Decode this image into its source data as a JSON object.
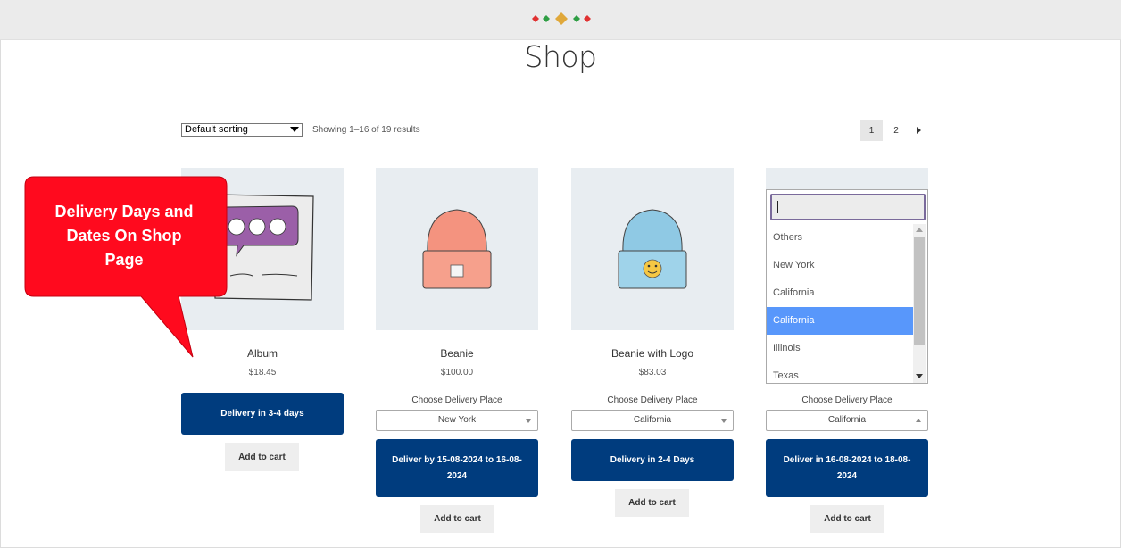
{
  "page": {
    "title": "Shop"
  },
  "header": {
    "logo_icon": "woocommerce-diamond-logo-icon",
    "logo_colors": [
      "#e03131",
      "#2f9e44",
      "#e0a83a",
      "#2f9e44",
      "#e03131"
    ]
  },
  "toolbar": {
    "sort_selected": "Default sorting",
    "result_count": "Showing 1–16 of 19 results",
    "pagination": {
      "page1": "1",
      "page2": "2",
      "next_icon": "next-arrow-icon"
    }
  },
  "callout": {
    "line1": "Delivery Days and",
    "line2": "Dates On Shop",
    "line3": "Page",
    "color": "#ff0a1e"
  },
  "products": [
    {
      "name": "Album",
      "price": "$18.45",
      "delivery_text": "Delivery in 3-4 days",
      "cart_label": "Add to cart"
    },
    {
      "name": "Beanie",
      "price": "$100.00",
      "choose_label": "Choose Delivery Place",
      "place": "New York",
      "delivery_text": "Deliver by 15-08-2024 to 16-08-2024",
      "cart_label": "Add to cart"
    },
    {
      "name": "Beanie with Logo",
      "price": "$83.03",
      "choose_label": "Choose Delivery Place",
      "place": "California",
      "delivery_text": "Delivery in 2-4 Days",
      "cart_label": "Add to cart"
    },
    {
      "choose_label": "Choose Delivery Place",
      "place": "California",
      "delivery_text": "Deliver in 16-08-2024 to 18-08-2024",
      "cart_label": "Add to cart"
    }
  ],
  "dropdown": {
    "search_value": "",
    "options": [
      "Others",
      "New York",
      "California",
      "California",
      "Illinois",
      "Texas"
    ],
    "highlighted_index": 3
  },
  "colors": {
    "button_blue": "#003c7e",
    "highlight_blue": "#5897fb",
    "thumb_bg": "#e8edf1"
  }
}
